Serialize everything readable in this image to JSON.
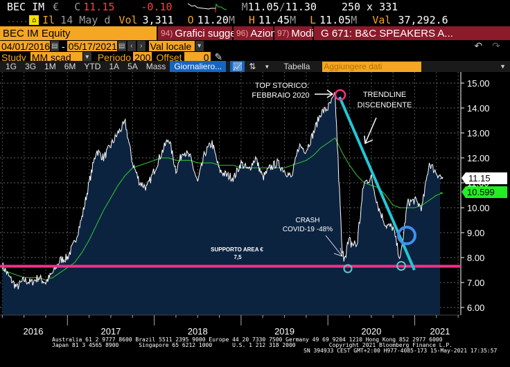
{
  "header": {
    "ticker": "BEC IM",
    "currency": "€",
    "c_label": "C",
    "last": "11.15",
    "change": "-0.10",
    "m_label": "M",
    "bid": "11.05",
    "ask": "11.30",
    "size": "250 x 331",
    "il": "Il",
    "date": "14 May d",
    "vol_label": "Vol",
    "vol": "3,311",
    "o_label": "O",
    "open": "11.20",
    "h_label": "H",
    "high": "11.45",
    "l_label": "L",
    "low": "11.05",
    "val_label": "Val",
    "val": "37,292.6",
    "m_suffix": "M"
  },
  "bar": {
    "security": "BEC IM Equity",
    "s1_num": "94)",
    "s1": "Grafici suggeriti",
    "s2_num": "96)",
    "s2": "Azioni",
    "s3_num": "97)",
    "s3": "Modif",
    "title": "G 671: B&C SPEAKERS A..."
  },
  "controls": {
    "start": "04/01/2016",
    "dash": "-",
    "end": "05/17/2021",
    "currency_sel": "Val locale",
    "study_label": "Study",
    "study": "MM scad",
    "periodo_label": "Periodo",
    "periodo": "200",
    "offset_label": "Offset",
    "offset": "0"
  },
  "tabs": [
    "1G",
    "3G",
    "1M",
    "6M",
    "YTD",
    "1A",
    "5A",
    "Mass",
    "Giornaliero..."
  ],
  "table_label": "Tabella",
  "add_data_placeholder": "Aggiungere dati",
  "annotations": {
    "top1": "TOP STORICO:",
    "top2": "FEBBRAIO 2020",
    "trend1": "TRENDLINE",
    "trend2": "DISCENDENTE",
    "crash1": "CRASH",
    "crash2": "COVID-19 -48%",
    "sup1": "SUPPORTO AREA €",
    "sup2": "7,5"
  },
  "price_tags": {
    "last": "11.15",
    "ma": "10.599"
  },
  "colors": {
    "accent": "#f5a623",
    "red_bar": "#8b1a2b",
    "support": "#ff2d8a",
    "trend": "#22c7d6",
    "ma": "#33cc33"
  },
  "footer": {
    "l1": "Australia 61 2 9777 8600 Brazil 5511 2395 9000 Europe 44 20 7330 7500 Germany 49 69 9204 1210 Hong Kong 852 2977 6000",
    "l2": "Japan 81 3 4565 8900      Singapore 65 6212 1000      U.S. 1 212 318 2000          Copyright 2021 Bloomberg Finance L.P.",
    "l3": "SN 394933 CEST GMT+2:00 H977-4085-173 15-May-2021 17:35:57"
  },
  "chart_data": {
    "type": "line",
    "title": "BEC IM Equity",
    "ylim": [
      6,
      15
    ],
    "yticks": [
      "15.00",
      "14.00",
      "13.00",
      "12.00",
      "11.00",
      "10.00",
      "9.00",
      "8.00",
      "7.00",
      "6.00"
    ],
    "xlabels": [
      "2016",
      "2017",
      "2018",
      "2019",
      "2020",
      "2021"
    ],
    "x": [
      "2016-04",
      "2016-05",
      "2016-06",
      "2016-07",
      "2016-08",
      "2016-09",
      "2016-10",
      "2016-11",
      "2016-12",
      "2017-01",
      "2017-02",
      "2017-03",
      "2017-04",
      "2017-05",
      "2017-06",
      "2017-07",
      "2017-08",
      "2017-09",
      "2017-10",
      "2017-11",
      "2017-12",
      "2018-01",
      "2018-02",
      "2018-03",
      "2018-04",
      "2018-05",
      "2018-06",
      "2018-07",
      "2018-08",
      "2018-09",
      "2018-10",
      "2018-11",
      "2018-12",
      "2019-01",
      "2019-02",
      "2019-03",
      "2019-04",
      "2019-05",
      "2019-06",
      "2019-07",
      "2019-08",
      "2019-09",
      "2019-10",
      "2019-11",
      "2019-12",
      "2020-01",
      "2020-02",
      "2020-03",
      "2020-04",
      "2020-05",
      "2020-06",
      "2020-07",
      "2020-08",
      "2020-09",
      "2020-10",
      "2020-11",
      "2020-12",
      "2021-01",
      "2021-02",
      "2021-03",
      "2021-04",
      "2021-05"
    ],
    "series": [
      {
        "name": "Prezzo",
        "values": [
          7.7,
          7.2,
          6.8,
          7.1,
          7.0,
          7.2,
          7.0,
          7.4,
          7.9,
          8.0,
          8.6,
          9.6,
          11.0,
          12.3,
          12.0,
          12.5,
          13.0,
          13.4,
          11.8,
          11.0,
          10.8,
          11.5,
          12.2,
          12.8,
          11.5,
          12.3,
          12.0,
          11.0,
          12.2,
          12.6,
          11.5,
          11.3,
          11.2,
          11.8,
          11.5,
          12.0,
          11.2,
          11.6,
          11.8,
          11.5,
          11.2,
          12.5,
          12.3,
          13.0,
          13.8,
          14.0,
          14.5,
          8.0,
          8.6,
          8.5,
          11.0,
          11.2,
          10.0,
          9.3,
          9.2,
          7.9,
          10.2,
          10.3,
          10.0,
          11.8,
          11.4,
          11.15
        ]
      },
      {
        "name": "MM scad 200",
        "values": [
          7.5,
          7.4,
          7.3,
          7.2,
          7.2,
          7.2,
          7.1,
          7.2,
          7.4,
          7.6,
          7.8,
          8.2,
          8.7,
          9.3,
          9.9,
          10.4,
          10.9,
          11.3,
          11.6,
          11.7,
          11.8,
          11.9,
          12.0,
          12.0,
          11.9,
          11.9,
          11.9,
          11.8,
          11.8,
          11.8,
          11.7,
          11.7,
          11.7,
          11.6,
          11.6,
          11.6,
          11.6,
          11.6,
          11.6,
          11.6,
          11.7,
          11.8,
          11.9,
          12.1,
          12.4,
          12.6,
          12.8,
          12.2,
          11.7,
          11.3,
          11.0,
          10.9,
          10.8,
          10.5,
          10.1,
          10.0,
          10.0,
          10.0,
          10.1,
          10.3,
          10.5,
          10.6
        ]
      }
    ],
    "support_level": 7.65
  }
}
